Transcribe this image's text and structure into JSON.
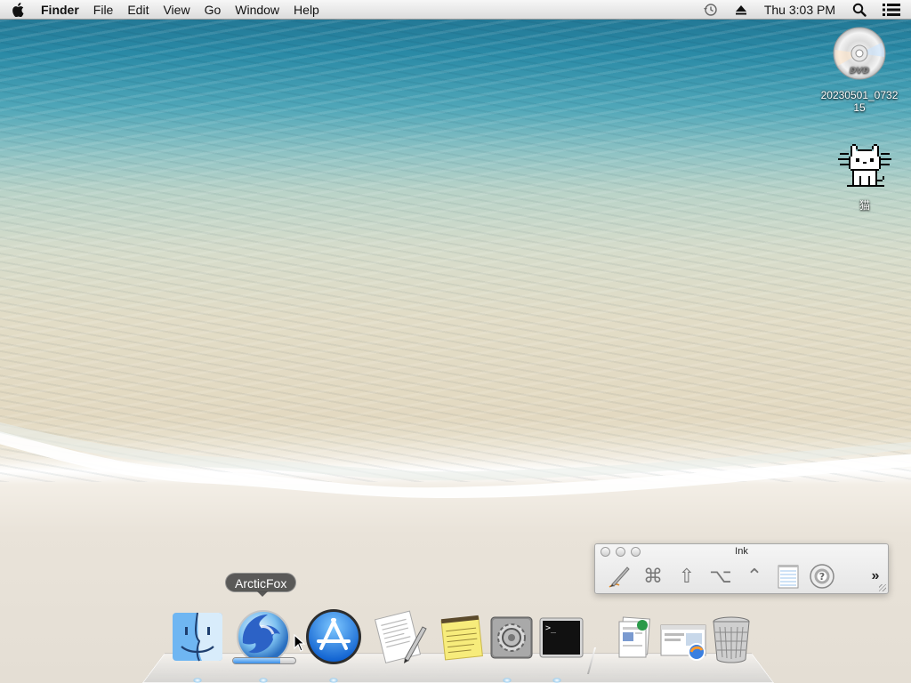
{
  "menubar": {
    "app_name": "Finder",
    "menus": [
      "File",
      "Edit",
      "View",
      "Go",
      "Window",
      "Help"
    ],
    "clock": "Thu 3:03 PM",
    "status_icons": [
      "time-machine-icon",
      "eject-icon",
      "spotlight-icon",
      "notification-list-icon"
    ]
  },
  "desktop": {
    "icons": [
      {
        "label": "20230501_073215",
        "icon": "dvd-icon"
      },
      {
        "label": "猫",
        "icon": "pixel-cat-icon"
      }
    ]
  },
  "ink": {
    "title": "Ink",
    "tools": [
      "pen-icon",
      "command-key-icon",
      "shift-key-icon",
      "option-key-icon",
      "control-key-icon",
      "notepad-icon",
      "help-icon"
    ],
    "more": "»"
  },
  "dock": {
    "tooltip": "ArcticFox",
    "download_progress": 0.75,
    "apps": [
      "Finder",
      "ArcticFox",
      "App Store",
      "TextEdit",
      "Stickies",
      "System Preferences",
      "Terminal"
    ],
    "others": [
      "Documents",
      "Downloads",
      "Trash"
    ]
  },
  "colors": {
    "menubar": "#e8e8e8",
    "water": "#2a8aa6",
    "sand": "#e4ded4"
  }
}
